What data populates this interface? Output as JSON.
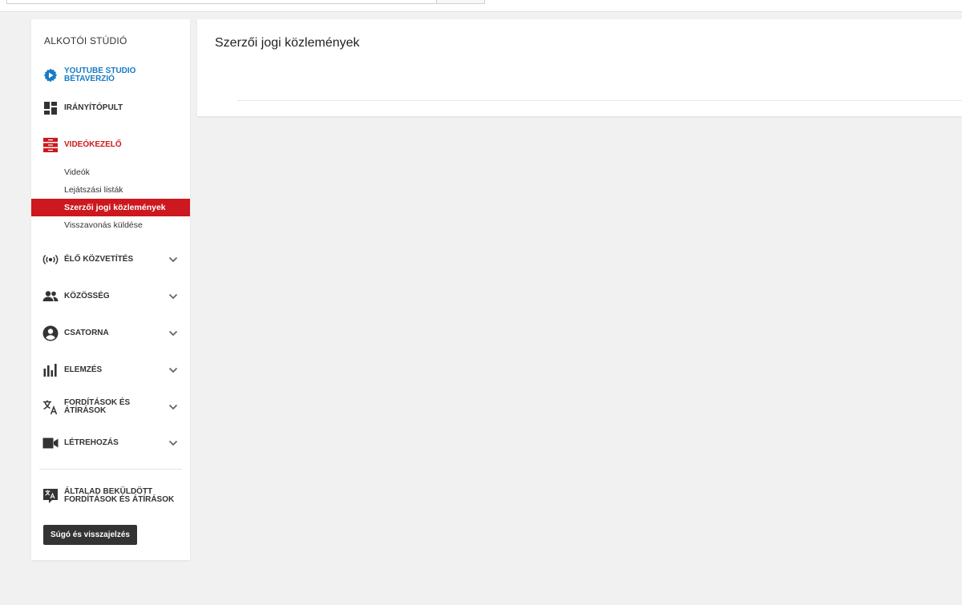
{
  "sidebar": {
    "title": "ALKOTÓI STÚDIÓ",
    "studio_beta": "YOUTUBE STUDIO BÉTAVERZIÓ",
    "dashboard": "IRÁNYÍTÓPULT",
    "video_manager": "VIDEÓKEZELŐ",
    "sub_items": [
      "Videók",
      "Lejátszási listák",
      "Szerzői jogi közlemények",
      "Visszavonás küldése"
    ],
    "live": "ÉLŐ KÖZVETÍTÉS",
    "community": "KÖZÖSSÉG",
    "channel": "CSATORNA",
    "analytics": "ELEMZÉS",
    "translations": "FORDÍTÁSOK ÉS ÁTÍRÁSOK",
    "create": "LÉTREHOZÁS",
    "your_translations": "ÁLTALAD BEKÜLDÖTT FORDÍTÁSOK ÉS ÁTÍRÁSOK",
    "help_button": "Súgó és visszajelzés"
  },
  "main": {
    "title": "Szerzői jogi közlemények"
  },
  "colors": {
    "accent_red": "#cc181e",
    "studio_blue": "#167ac6",
    "background": "#f1f1f1"
  },
  "icons": {
    "studio_beta": "gear-play-icon",
    "dashboard": "dashboard-icon",
    "video_manager": "video-manager-icon",
    "live": "live-broadcast-icon",
    "community": "people-icon",
    "channel": "account-circle-icon",
    "analytics": "bar-chart-icon",
    "translations": "translate-icon",
    "create": "video-camera-icon",
    "your_translations": "translate-box-icon",
    "expand": "chevron-down-icon"
  }
}
